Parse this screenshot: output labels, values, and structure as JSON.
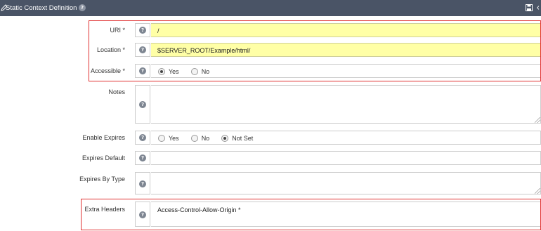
{
  "header": {
    "title": "Static Context Definition",
    "help_glyph": "?",
    "icons": [
      "edit-icon",
      "help-icon",
      "save-icon"
    ]
  },
  "form": {
    "uri": {
      "label": "URI *",
      "value": "/"
    },
    "location": {
      "label": "Location *",
      "value": "$SERVER_ROOT/Example/html/"
    },
    "accessible": {
      "label": "Accessible *",
      "options": [
        "Yes",
        "No"
      ],
      "selected": "Yes"
    },
    "notes": {
      "label": "Notes",
      "value": ""
    },
    "enable_expires": {
      "label": "Enable Expires",
      "options": [
        "Yes",
        "No",
        "Not Set"
      ],
      "selected": "Not Set"
    },
    "expires_default": {
      "label": "Expires Default",
      "value": ""
    },
    "expires_by_type": {
      "label": "Expires By Type",
      "value": ""
    },
    "extra_headers": {
      "label": "Extra Headers",
      "value": "Access-Control-Allow-Origin *"
    }
  },
  "colors": {
    "titlebar": "#4a5466",
    "highlight_field": "#ffffa6",
    "annotation_red": "#e03030"
  }
}
